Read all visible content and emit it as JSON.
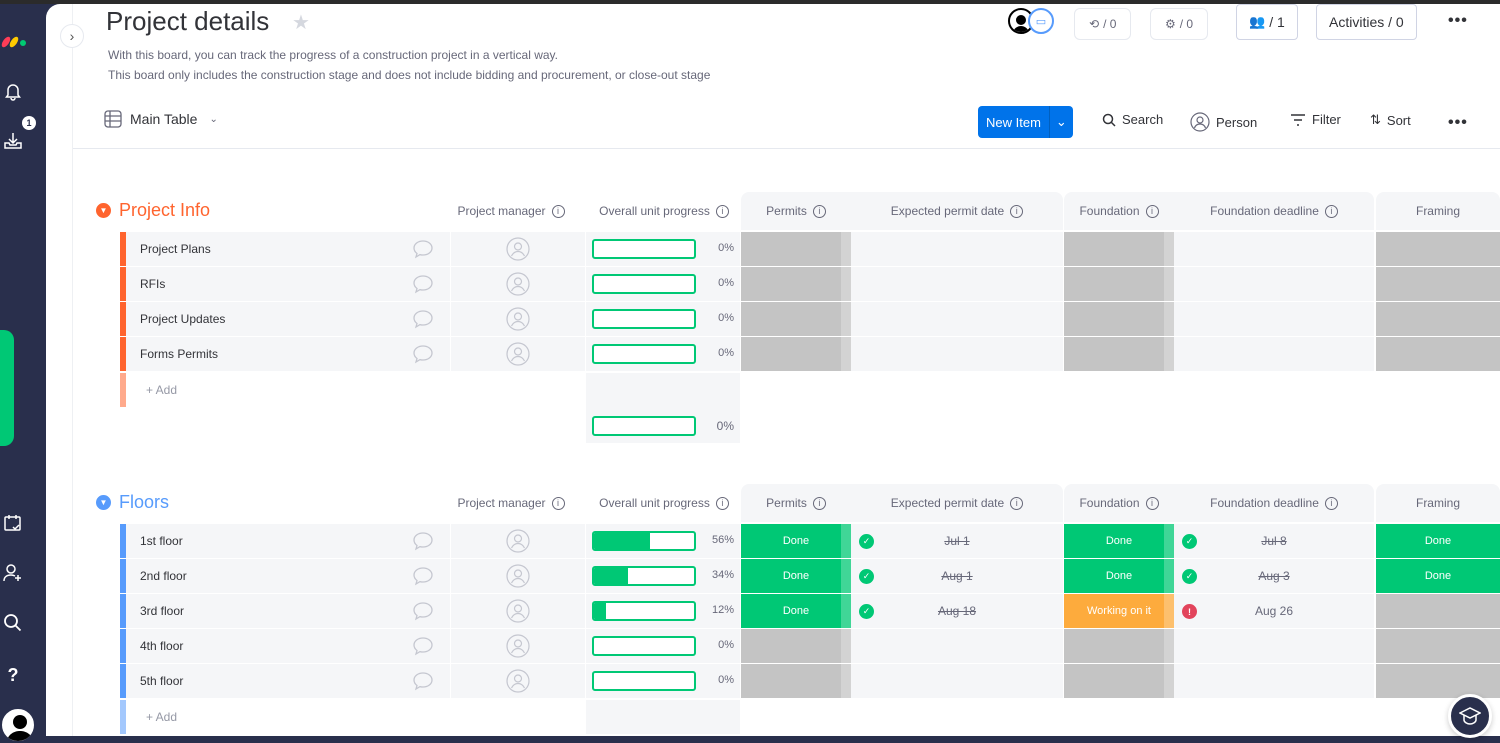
{
  "nav": {
    "badge_count": "1",
    "icons": [
      "bell-icon",
      "inbox-download-icon",
      "calendar-check-icon",
      "invite-user-icon",
      "search-icon",
      "help-icon"
    ]
  },
  "header": {
    "title": "Project details",
    "description_line1": "With this board, you can track the progress of a construction project in a vertical way.",
    "description_line2": "This board only includes the construction stage and does not include bidding and procurement, or close-out stage",
    "integrations_count": "/ 0",
    "automations_count": "/ 0",
    "members_count": "/ 1",
    "activities_label": "Activities / 0"
  },
  "toolbar": {
    "view_label": "Main Table",
    "new_item_label": "New Item",
    "search_label": "Search",
    "person_label": "Person",
    "filter_label": "Filter",
    "sort_label": "Sort"
  },
  "columns": {
    "project_manager": "Project manager",
    "overall_progress": "Overall unit progress",
    "permits": "Permits",
    "expected_permit_date": "Expected permit date",
    "foundation": "Foundation",
    "foundation_deadline": "Foundation deadline",
    "framing": "Framing"
  },
  "colors": {
    "done": "#00c875",
    "working": "#fdab3d",
    "empty": "#c4c4c4",
    "project_info": "#ff642e",
    "floors": "#579bfc"
  },
  "groups": [
    {
      "title": "Project Info",
      "add_label": "+ Add",
      "summary_progress": "0%",
      "summary_progress_value": 0,
      "rows": [
        {
          "name": "Project Plans",
          "progress": "0%",
          "progress_value": 0,
          "permits": "",
          "permit_date": "",
          "foundation": "",
          "foundation_deadline": "",
          "framing": ""
        },
        {
          "name": "RFIs",
          "progress": "0%",
          "progress_value": 0,
          "permits": "",
          "permit_date": "",
          "foundation": "",
          "foundation_deadline": "",
          "framing": ""
        },
        {
          "name": "Project Updates",
          "progress": "0%",
          "progress_value": 0,
          "permits": "",
          "permit_date": "",
          "foundation": "",
          "foundation_deadline": "",
          "framing": ""
        },
        {
          "name": "Forms Permits",
          "progress": "0%",
          "progress_value": 0,
          "permits": "",
          "permit_date": "",
          "foundation": "",
          "foundation_deadline": "",
          "framing": ""
        }
      ]
    },
    {
      "title": "Floors",
      "add_label": "+ Add",
      "rows": [
        {
          "name": "1st floor",
          "progress": "56%",
          "progress_value": 56,
          "permits": "Done",
          "permit_date": "Jul 1",
          "permit_date_status": "done",
          "foundation": "Done",
          "foundation_deadline": "Jul 8",
          "foundation_deadline_status": "done",
          "framing": "Done"
        },
        {
          "name": "2nd floor",
          "progress": "34%",
          "progress_value": 34,
          "permits": "Done",
          "permit_date": "Aug 1",
          "permit_date_status": "done",
          "foundation": "Done",
          "foundation_deadline": "Aug 3",
          "foundation_deadline_status": "done",
          "framing": "Done"
        },
        {
          "name": "3rd floor",
          "progress": "12%",
          "progress_value": 12,
          "permits": "Done",
          "permit_date": "Aug 18",
          "permit_date_status": "done",
          "foundation": "Working on it",
          "foundation_deadline": "Aug 26",
          "foundation_deadline_status": "overdue",
          "framing": ""
        },
        {
          "name": "4th floor",
          "progress": "0%",
          "progress_value": 0,
          "permits": "",
          "permit_date": "",
          "foundation": "",
          "foundation_deadline": "",
          "framing": ""
        },
        {
          "name": "5th floor",
          "progress": "0%",
          "progress_value": 0,
          "permits": "",
          "permit_date": "",
          "foundation": "",
          "foundation_deadline": "",
          "framing": ""
        }
      ]
    }
  ]
}
